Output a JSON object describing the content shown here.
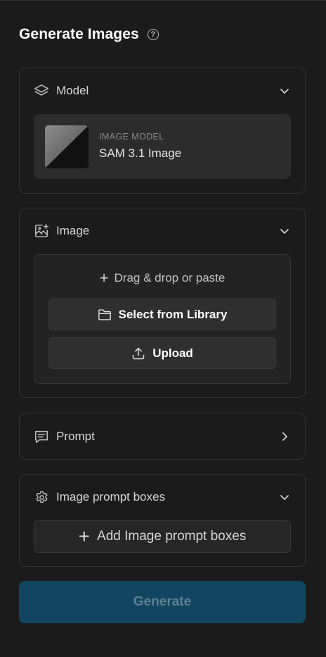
{
  "header": {
    "title": "Generate Images",
    "help_icon": "question-circle-icon"
  },
  "model": {
    "label": "Model",
    "caption": "IMAGE MODEL",
    "name": "SAM 3.1 Image"
  },
  "image": {
    "label": "Image",
    "drop_text": "Drag & drop or paste",
    "select_library": "Select from Library",
    "upload": "Upload"
  },
  "prompt": {
    "label": "Prompt"
  },
  "boxes": {
    "label": "Image prompt boxes",
    "add_label": "Add Image prompt boxes"
  },
  "generate": {
    "label": "Generate"
  },
  "colors": {
    "background": "#1b1b1b",
    "card_border": "#333333",
    "generate_bg": "#124660",
    "generate_text": "#5f7f90"
  }
}
